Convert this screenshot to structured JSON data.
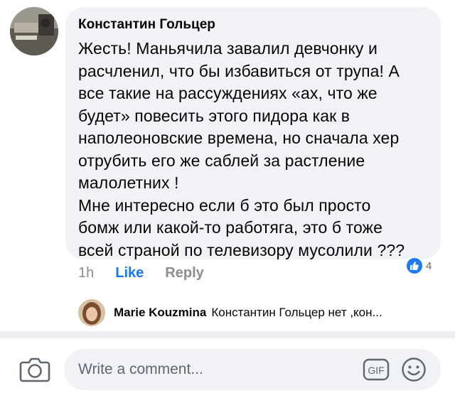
{
  "comment": {
    "author": "Константин Гольцер",
    "text": "Жесть! Маньячила завалил девчонку и\nрасчленил, что бы избавиться от трупа! А\nвсе такие на рассуждениях «ах, что же\nбудет»  повесить этого пидора как в\nнаполеоновские времена, но сначала хер\nотрубить его же саблей за растление\nмалолетних !\nМне интересно если б это был просто\nбомж или какой-то работяга, это б тоже\nвсей страной по телевизору мусолили ???",
    "time": "1h",
    "like_label": "Like",
    "reply_label": "Reply",
    "reaction_icon": "like-icon",
    "reaction_count": "4"
  },
  "reply_preview": {
    "author": "Marie Kouzmina",
    "text": "Константин Гольцер нет ,кон..."
  },
  "composer": {
    "placeholder": "Write a comment...",
    "camera_icon": "camera-icon",
    "gif_label": "GIF",
    "emoji_icon": "emoji-icon"
  },
  "colors": {
    "accent": "#1877f2",
    "bubble_bg": "#f0f2f5",
    "secondary_text": "#8a8d91"
  }
}
